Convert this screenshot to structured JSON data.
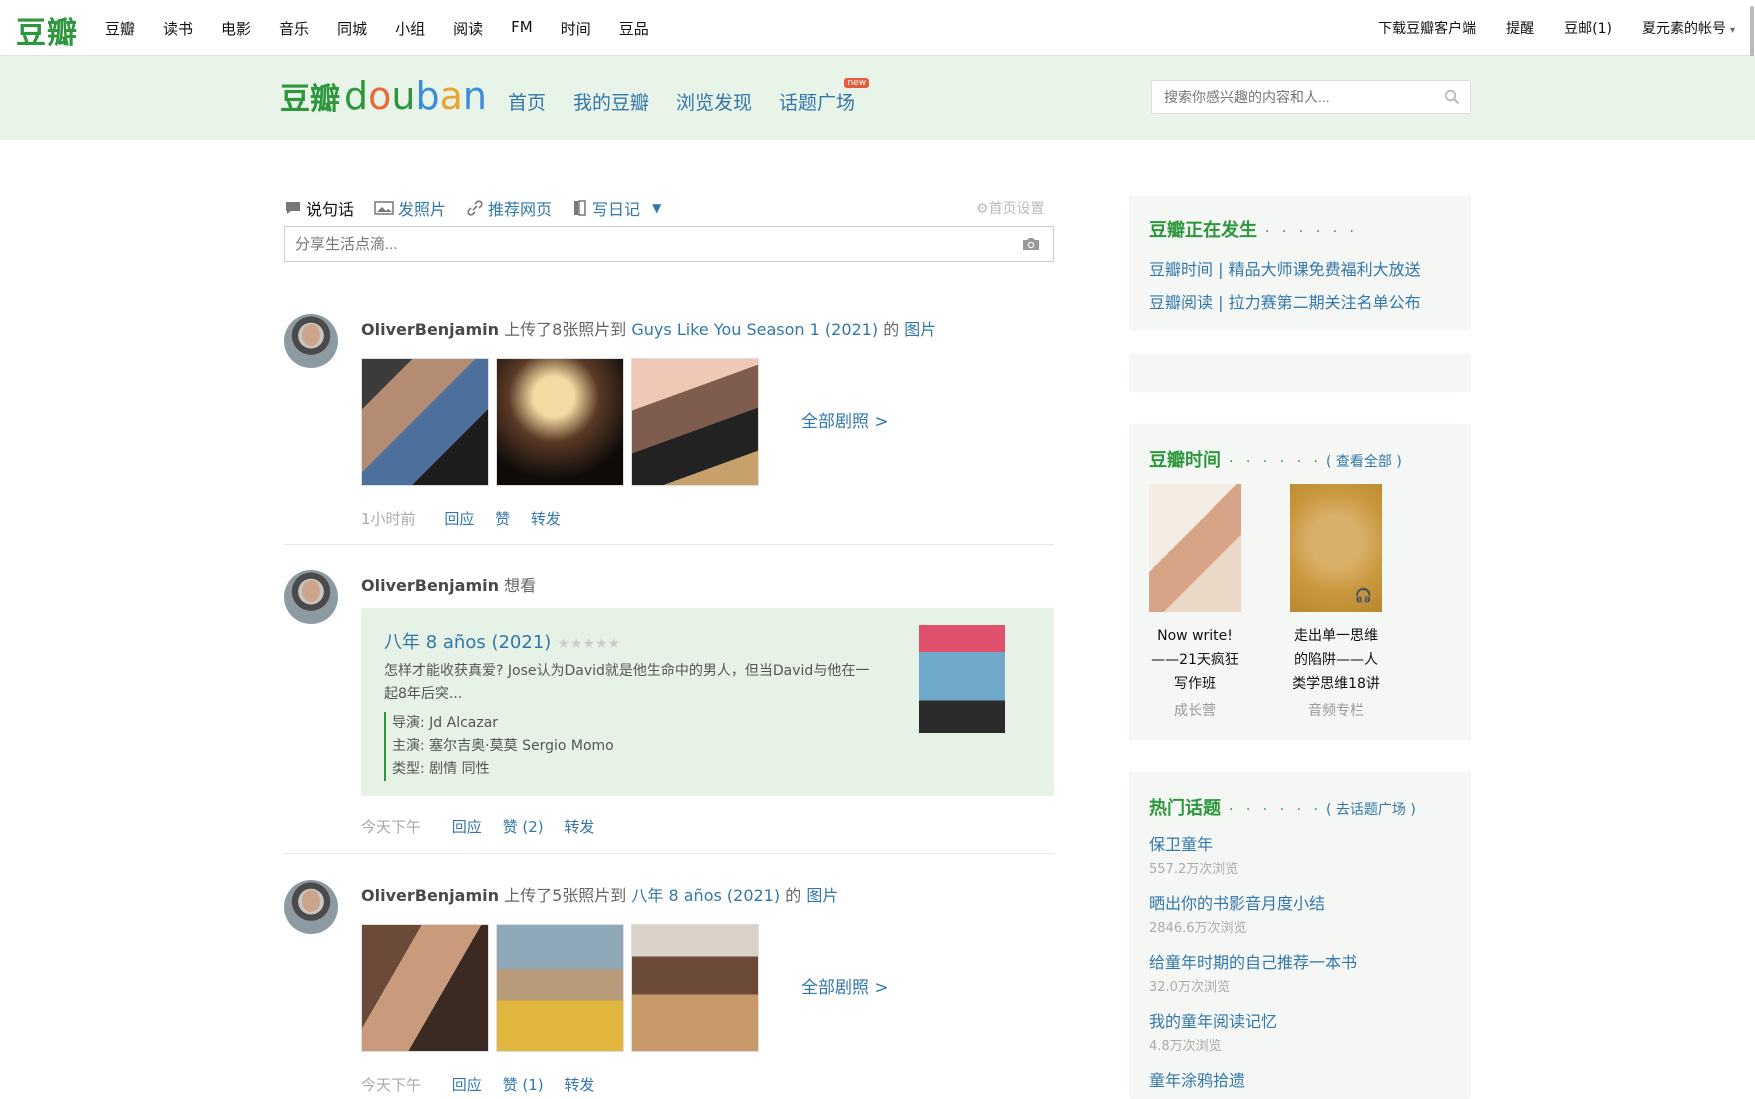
{
  "topbar": {
    "brand": "豆瓣",
    "nav": [
      "豆瓣",
      "读书",
      "电影",
      "音乐",
      "同城",
      "小组",
      "阅读",
      "FM",
      "时间",
      "豆品"
    ],
    "right": [
      "下载豆瓣客户端",
      "提醒",
      "豆邮(1)",
      "夏元素的帐号"
    ]
  },
  "subheader": {
    "logo_cn": "豆瓣",
    "logo_en": "douban",
    "nav": [
      "首页",
      "我的豆瓣",
      "浏览发现",
      "话题广场"
    ],
    "new_badge": "new",
    "search_placeholder": "搜索你感兴趣的内容和人..."
  },
  "composer": {
    "tabs": [
      "说句话",
      "发照片",
      "推荐网页",
      "写日记"
    ],
    "settings": "首页设置",
    "placeholder": "分享生活点滴..."
  },
  "feed": [
    {
      "user": "OliverBenjamin",
      "action": "上传了8张照片到",
      "target": "Guys Like You Season 1 (2021)",
      "suffix": "的",
      "suffix_link": "图片",
      "view_all": "全部剧照 >",
      "time": "1小时前",
      "actions": [
        "回应",
        "赞",
        "转发"
      ]
    },
    {
      "user": "OliverBenjamin",
      "action": "想看",
      "movie": {
        "title": "八年 8 años (2021)",
        "stars": "★★★★★",
        "desc": "怎样才能收获真爱? Jose认为David就是他生命中的男人，但当David与他在一起8年后突...",
        "director": "导演: Jd Alcazar",
        "cast": "主演: 塞尔吉奥·莫莫 Sergio Momo",
        "genre": "类型: 剧情 同性"
      },
      "time": "今天下午",
      "actions": [
        "回应",
        "赞 (2)",
        "转发"
      ]
    },
    {
      "user": "OliverBenjamin",
      "action": "上传了5张照片到",
      "target": "八年 8 años (2021)",
      "suffix": "的",
      "suffix_link": "图片",
      "view_all": "全部剧照 >",
      "time": "今天下午",
      "actions": [
        "回应",
        "赞 (1)",
        "转发"
      ]
    }
  ],
  "sidebar": {
    "happening": {
      "title": "豆瓣正在发生",
      "dots": "· · · · · ·",
      "links": [
        "豆瓣时间 | 精品大师课免费福利大放送",
        "豆瓣阅读 | 拉力赛第二期关注名单公布"
      ]
    },
    "time": {
      "title": "豆瓣时间",
      "dots": "· · · · · ·",
      "more": "( 查看全部 )",
      "items": [
        {
          "name_l1": "Now write!",
          "name_l2": "——21天疯狂",
          "name_l3": "写作班",
          "kind": "成长营"
        },
        {
          "name_l1": "走出单一思维",
          "name_l2": "的陷阱——人",
          "name_l3": "类学思维18讲",
          "kind": "音频专栏"
        }
      ]
    },
    "topics": {
      "title": "热门话题",
      "dots": "· · · · · ·",
      "more": "( 去话题广场 )",
      "items": [
        {
          "name": "保卫童年",
          "count": "557.2万次浏览"
        },
        {
          "name": "晒出你的书影音月度小结",
          "count": "2846.6万次浏览"
        },
        {
          "name": "给童年时期的自己推荐一本书",
          "count": "32.0万次浏览"
        },
        {
          "name": "我的童年阅读记忆",
          "count": "4.8万次浏览"
        },
        {
          "name": "童年涂鸦拾遗",
          "count": ""
        }
      ]
    }
  },
  "colors": {
    "brand_green": "#2e963d",
    "link_blue": "#3377aa",
    "header_bg": "#e9f4e9",
    "card_bg": "#e6f2e6"
  }
}
